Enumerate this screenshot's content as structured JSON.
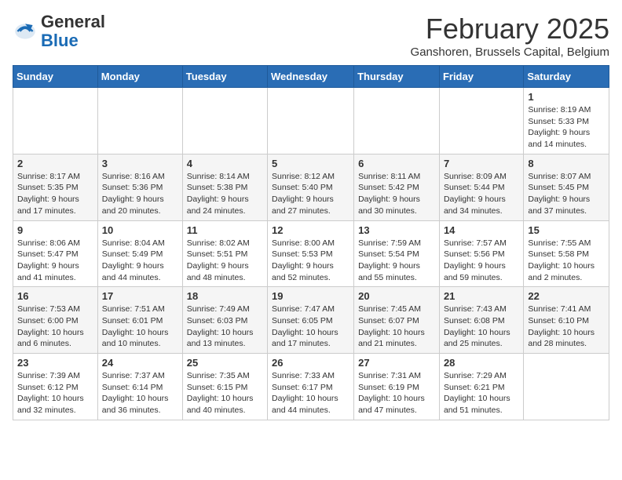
{
  "header": {
    "logo_general": "General",
    "logo_blue": "Blue",
    "month_title": "February 2025",
    "location": "Ganshoren, Brussels Capital, Belgium"
  },
  "weekdays": [
    "Sunday",
    "Monday",
    "Tuesday",
    "Wednesday",
    "Thursday",
    "Friday",
    "Saturday"
  ],
  "weeks": [
    [
      {
        "day": "",
        "info": ""
      },
      {
        "day": "",
        "info": ""
      },
      {
        "day": "",
        "info": ""
      },
      {
        "day": "",
        "info": ""
      },
      {
        "day": "",
        "info": ""
      },
      {
        "day": "",
        "info": ""
      },
      {
        "day": "1",
        "info": "Sunrise: 8:19 AM\nSunset: 5:33 PM\nDaylight: 9 hours and 14 minutes."
      }
    ],
    [
      {
        "day": "2",
        "info": "Sunrise: 8:17 AM\nSunset: 5:35 PM\nDaylight: 9 hours and 17 minutes."
      },
      {
        "day": "3",
        "info": "Sunrise: 8:16 AM\nSunset: 5:36 PM\nDaylight: 9 hours and 20 minutes."
      },
      {
        "day": "4",
        "info": "Sunrise: 8:14 AM\nSunset: 5:38 PM\nDaylight: 9 hours and 24 minutes."
      },
      {
        "day": "5",
        "info": "Sunrise: 8:12 AM\nSunset: 5:40 PM\nDaylight: 9 hours and 27 minutes."
      },
      {
        "day": "6",
        "info": "Sunrise: 8:11 AM\nSunset: 5:42 PM\nDaylight: 9 hours and 30 minutes."
      },
      {
        "day": "7",
        "info": "Sunrise: 8:09 AM\nSunset: 5:44 PM\nDaylight: 9 hours and 34 minutes."
      },
      {
        "day": "8",
        "info": "Sunrise: 8:07 AM\nSunset: 5:45 PM\nDaylight: 9 hours and 37 minutes."
      }
    ],
    [
      {
        "day": "9",
        "info": "Sunrise: 8:06 AM\nSunset: 5:47 PM\nDaylight: 9 hours and 41 minutes."
      },
      {
        "day": "10",
        "info": "Sunrise: 8:04 AM\nSunset: 5:49 PM\nDaylight: 9 hours and 44 minutes."
      },
      {
        "day": "11",
        "info": "Sunrise: 8:02 AM\nSunset: 5:51 PM\nDaylight: 9 hours and 48 minutes."
      },
      {
        "day": "12",
        "info": "Sunrise: 8:00 AM\nSunset: 5:53 PM\nDaylight: 9 hours and 52 minutes."
      },
      {
        "day": "13",
        "info": "Sunrise: 7:59 AM\nSunset: 5:54 PM\nDaylight: 9 hours and 55 minutes."
      },
      {
        "day": "14",
        "info": "Sunrise: 7:57 AM\nSunset: 5:56 PM\nDaylight: 9 hours and 59 minutes."
      },
      {
        "day": "15",
        "info": "Sunrise: 7:55 AM\nSunset: 5:58 PM\nDaylight: 10 hours and 2 minutes."
      }
    ],
    [
      {
        "day": "16",
        "info": "Sunrise: 7:53 AM\nSunset: 6:00 PM\nDaylight: 10 hours and 6 minutes."
      },
      {
        "day": "17",
        "info": "Sunrise: 7:51 AM\nSunset: 6:01 PM\nDaylight: 10 hours and 10 minutes."
      },
      {
        "day": "18",
        "info": "Sunrise: 7:49 AM\nSunset: 6:03 PM\nDaylight: 10 hours and 13 minutes."
      },
      {
        "day": "19",
        "info": "Sunrise: 7:47 AM\nSunset: 6:05 PM\nDaylight: 10 hours and 17 minutes."
      },
      {
        "day": "20",
        "info": "Sunrise: 7:45 AM\nSunset: 6:07 PM\nDaylight: 10 hours and 21 minutes."
      },
      {
        "day": "21",
        "info": "Sunrise: 7:43 AM\nSunset: 6:08 PM\nDaylight: 10 hours and 25 minutes."
      },
      {
        "day": "22",
        "info": "Sunrise: 7:41 AM\nSunset: 6:10 PM\nDaylight: 10 hours and 28 minutes."
      }
    ],
    [
      {
        "day": "23",
        "info": "Sunrise: 7:39 AM\nSunset: 6:12 PM\nDaylight: 10 hours and 32 minutes."
      },
      {
        "day": "24",
        "info": "Sunrise: 7:37 AM\nSunset: 6:14 PM\nDaylight: 10 hours and 36 minutes."
      },
      {
        "day": "25",
        "info": "Sunrise: 7:35 AM\nSunset: 6:15 PM\nDaylight: 10 hours and 40 minutes."
      },
      {
        "day": "26",
        "info": "Sunrise: 7:33 AM\nSunset: 6:17 PM\nDaylight: 10 hours and 44 minutes."
      },
      {
        "day": "27",
        "info": "Sunrise: 7:31 AM\nSunset: 6:19 PM\nDaylight: 10 hours and 47 minutes."
      },
      {
        "day": "28",
        "info": "Sunrise: 7:29 AM\nSunset: 6:21 PM\nDaylight: 10 hours and 51 minutes."
      },
      {
        "day": "",
        "info": ""
      }
    ]
  ]
}
